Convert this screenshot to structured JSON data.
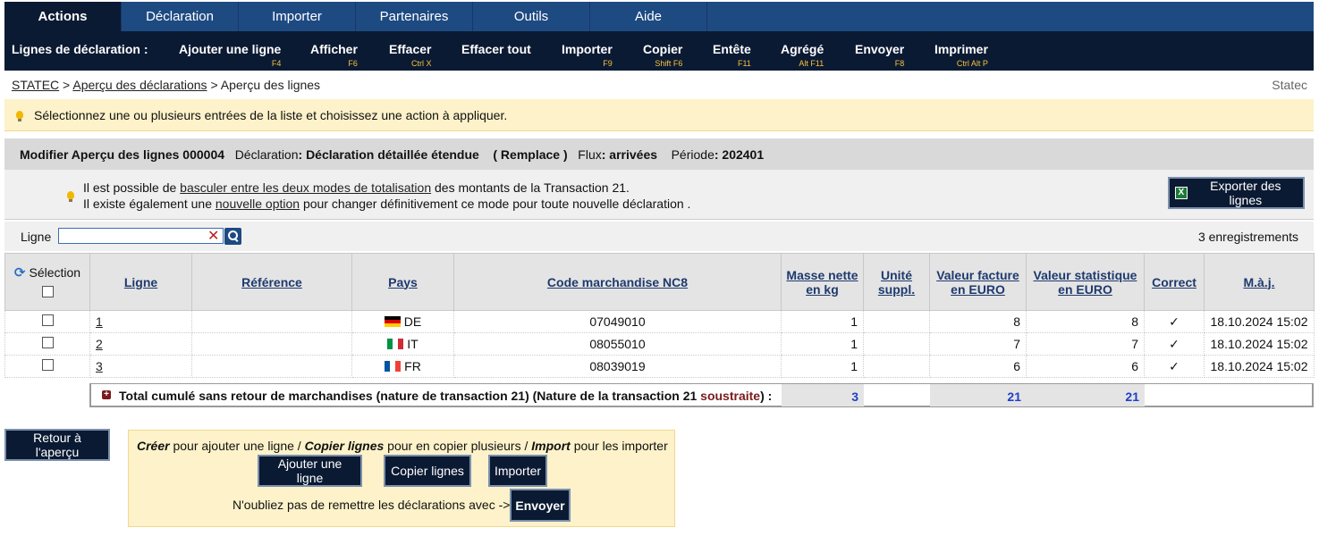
{
  "tabs": [
    "Actions",
    "Déclaration",
    "Importer",
    "Partenaires",
    "Outils",
    "Aide"
  ],
  "actionbar": {
    "title": "Lignes de déclaration :",
    "items": [
      {
        "label": "Ajouter une ligne",
        "shortcut": "F4"
      },
      {
        "label": "Afficher",
        "shortcut": "F6"
      },
      {
        "label": "Effacer",
        "shortcut": "Ctrl X"
      },
      {
        "label": "Effacer tout",
        "shortcut": ""
      },
      {
        "label": "Importer",
        "shortcut": "F9"
      },
      {
        "label": "Copier",
        "shortcut": "Shift F6"
      },
      {
        "label": "Entête",
        "shortcut": "F11"
      },
      {
        "label": "Agrégé",
        "shortcut": "Alt F11"
      },
      {
        "label": "Envoyer",
        "shortcut": "F8"
      },
      {
        "label": "Imprimer",
        "shortcut": "Ctrl Alt P"
      }
    ]
  },
  "breadcrumb": {
    "items": [
      "STATEC",
      "Aperçu des déclarations",
      "Aperçu des lignes"
    ],
    "sep": ">",
    "right": "Statec"
  },
  "info": {
    "text": "Sélectionnez une ou plusieurs entrées de la liste et choisissez une action à appliquer."
  },
  "panel": {
    "title": "Modifier Aperçu des lignes 000004",
    "decl_label": "Déclaration",
    "decl_value": ": Déclaration détaillée étendue",
    "decl_mode": "( Remplace )",
    "flux_label": "Flux",
    "flux_value": ": arrivées",
    "period_label": "Période",
    "period_value": ": 202401",
    "note1_a": "Il est possible de ",
    "note1_link": "basculer entre les deux modes de totalisation",
    "note1_b": " des montants de la Transaction 21.",
    "note2_a": "Il existe également une ",
    "note2_link": "nouvelle option",
    "note2_b": " pour changer définitivement ce mode pour toute nouvelle déclaration .",
    "export_label": "Exporter des lignes"
  },
  "filter": {
    "label": "Ligne",
    "value": "",
    "count": "3 enregistrements"
  },
  "table": {
    "selection_label": "Sélection",
    "headers": [
      "Ligne",
      "Référence",
      "Pays",
      "Code marchandise NC8",
      "Masse nette en kg",
      "Unité suppl.",
      "Valeur facture en EURO",
      "Valeur statistique en EURO",
      "Correct",
      "M.à.j."
    ],
    "rows": [
      {
        "ligne": "1",
        "reference": "",
        "pays": "DE",
        "code": "07049010",
        "masse": "1",
        "unite": "",
        "facture": "8",
        "stat": "8",
        "correct": "✓",
        "maj": "18.10.2024 15:02"
      },
      {
        "ligne": "2",
        "reference": "",
        "pays": "IT",
        "code": "08055010",
        "masse": "1",
        "unite": "",
        "facture": "7",
        "stat": "7",
        "correct": "✓",
        "maj": "18.10.2024 15:02"
      },
      {
        "ligne": "3",
        "reference": "",
        "pays": "FR",
        "code": "08039019",
        "masse": "1",
        "unite": "",
        "facture": "6",
        "stat": "6",
        "correct": "✓",
        "maj": "18.10.2024 15:02"
      }
    ]
  },
  "total": {
    "label_a": "Total cumulé sans retour de marchandises (nature de transaction 21) (Nature de la transaction 21 ",
    "label_red": "soustraite",
    "label_b": ") :",
    "masse": "3",
    "facture": "21",
    "stat": "21"
  },
  "bottom": {
    "back_label": "Retour à l'aperçu",
    "creer": "Créer",
    "t1_a": " pour ajouter une ligne / ",
    "copier": "Copier lignes",
    "t1_b": " pour en copier plusieurs / ",
    "import": "Import",
    "t1_c": " pour les importer",
    "btn_add": "Ajouter une ligne",
    "btn_copy": "Copier lignes",
    "btn_import": "Importer",
    "reminder": "N'oubliez pas de remettre les déclarations avec ->",
    "btn_send": "Envoyer"
  },
  "colors": {
    "nav": "#1e4a82",
    "dark": "#0b1a33",
    "shortcut": "#f6c23e",
    "info_bg": "#fdf2c9",
    "total_value": "#1f3fc8"
  }
}
